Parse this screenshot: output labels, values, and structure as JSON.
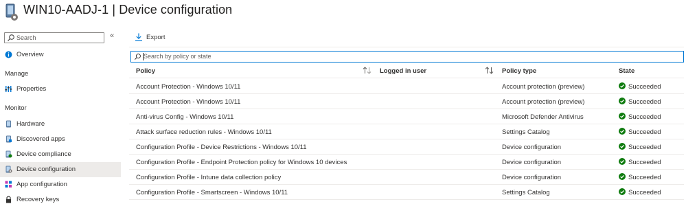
{
  "header": {
    "title": "WIN10-AADJ-1 | Device configuration",
    "more": "···",
    "device_icon": "device-gear-icon"
  },
  "sidebar": {
    "search_placeholder": "Search",
    "collapse": "«",
    "overview": "Overview",
    "sections": {
      "manage": "Manage",
      "monitor": "Monitor"
    },
    "manage_items": [
      {
        "label": "Properties",
        "icon": "properties-icon"
      }
    ],
    "monitor_items": [
      {
        "label": "Hardware",
        "icon": "hardware-icon"
      },
      {
        "label": "Discovered apps",
        "icon": "apps-icon"
      },
      {
        "label": "Device compliance",
        "icon": "compliance-icon"
      },
      {
        "label": "Device configuration",
        "icon": "configuration-icon",
        "selected": true
      },
      {
        "label": "App configuration",
        "icon": "app-config-icon"
      },
      {
        "label": "Recovery keys",
        "icon": "lock-icon"
      }
    ]
  },
  "toolbar": {
    "export_label": "Export"
  },
  "filter": {
    "placeholder": "Search by policy or state"
  },
  "table": {
    "columns": {
      "policy": "Policy",
      "logged_in_user": "Logged in user",
      "policy_type": "Policy type",
      "state": "State"
    },
    "rows": [
      {
        "policy": "Account Protection - Windows 10/11",
        "user": "",
        "type": "Account protection (preview)",
        "state": "Succeeded"
      },
      {
        "policy": "Account Protection - Windows 10/11",
        "user": "",
        "type": "Account protection (preview)",
        "state": "Succeeded"
      },
      {
        "policy": "Anti-virus Config - Windows 10/11",
        "user": "",
        "type": "Microsoft Defender Antivirus",
        "state": "Succeeded"
      },
      {
        "policy": "Attack surface reduction rules - Windows 10/11",
        "user": "",
        "type": "Settings Catalog",
        "state": "Succeeded"
      },
      {
        "policy": "Configuration Profile - Device Restrictions - Windows 10/11",
        "user": "",
        "type": "Device configuration",
        "state": "Succeeded"
      },
      {
        "policy": "Configuration Profile - Endpoint Protection policy for Windows 10 devices",
        "user": "",
        "type": "Device configuration",
        "state": "Succeeded"
      },
      {
        "policy": "Configuration Profile - Intune data collection policy",
        "user": "",
        "type": "Device configuration",
        "state": "Succeeded"
      },
      {
        "policy": "Configuration Profile - Smartscreen - Windows 10/11",
        "user": "",
        "type": "Settings Catalog",
        "state": "Succeeded"
      }
    ]
  },
  "colors": {
    "accent": "#0078d4",
    "success": "#107c10",
    "selected_bg": "#edebe9"
  }
}
